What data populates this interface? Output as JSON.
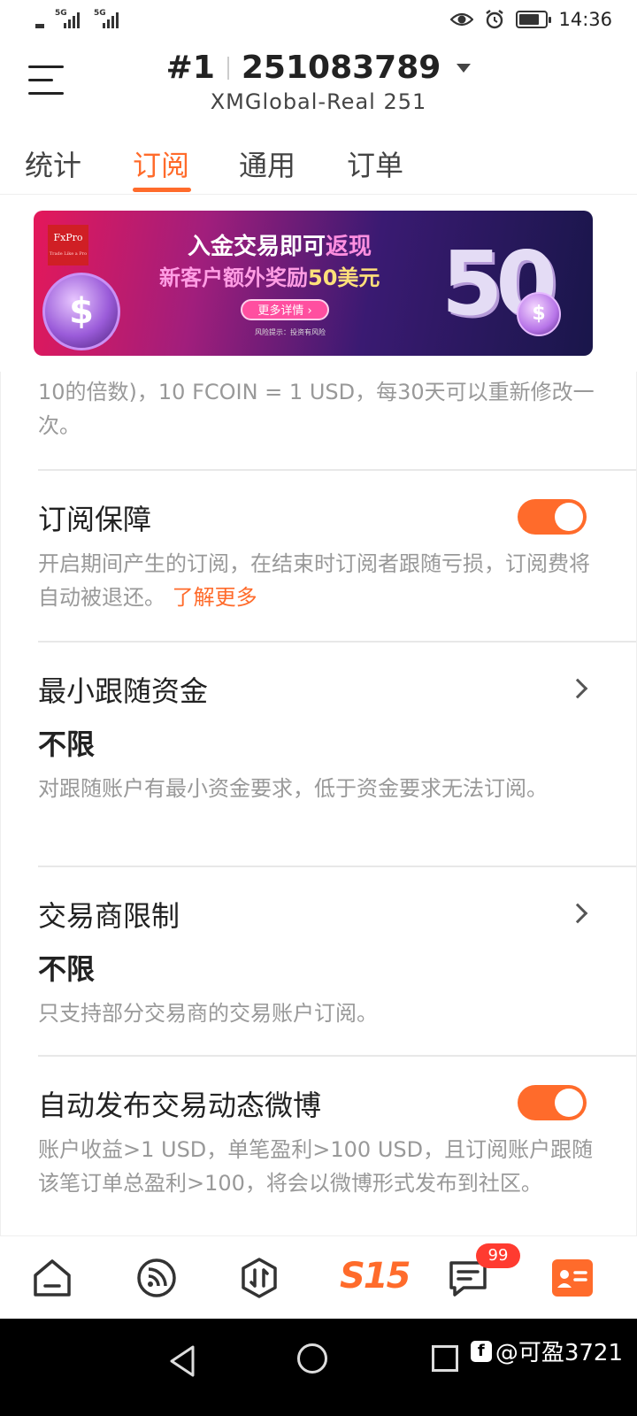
{
  "status_bar": {
    "signal1_label": "5G",
    "signal2_label": "5G",
    "time": "14:36"
  },
  "header": {
    "account_prefix": "#1",
    "account_number": "251083789",
    "server": "XMGlobal-Real 251"
  },
  "tabs": [
    {
      "label": "统计",
      "active": false
    },
    {
      "label": "订阅",
      "active": true
    },
    {
      "label": "通用",
      "active": false
    },
    {
      "label": "订单",
      "active": false
    }
  ],
  "banner": {
    "logo": "FxPro",
    "logo_tagline": "Trade Like a Pro",
    "line1_a": "入金交易即可",
    "line1_b": "返现",
    "line2_a": "新客户额外奖励",
    "line2_b": "50美元",
    "button": "更多详情",
    "risk": "风险提示：投资有风险",
    "big_number": "50"
  },
  "content": {
    "partial_text": "10的倍数)，10 FCOIN = 1 USD，每30天可以重新修改一次。",
    "sections": {
      "protection": {
        "title": "订阅保障",
        "desc": "开启期间产生的订阅，在结束时订阅者跟随亏损，订阅费将自动被退还。",
        "link": "了解更多",
        "toggle_on": true
      },
      "min_funds": {
        "title": "最小跟随资金",
        "value": "不限",
        "desc": "对跟随账户有最小资金要求，低于资金要求无法订阅。"
      },
      "broker_limit": {
        "title": "交易商限制",
        "value": "不限",
        "desc": "只支持部分交易商的交易账户订阅。"
      },
      "auto_post": {
        "title": "自动发布交易动态微博",
        "desc": "账户收益>1 USD，单笔盈利>100 USD，且订阅账户跟随该笔订单总盈利>100，将会以微博形式发布到社区。",
        "toggle_on": true
      }
    }
  },
  "bottom_nav": {
    "s15_label": "S15",
    "message_badge": "99"
  },
  "watermark": {
    "text": "@可盈3721"
  },
  "colors": {
    "accent": "#ff6b2b",
    "badge": "#ff3b30"
  }
}
